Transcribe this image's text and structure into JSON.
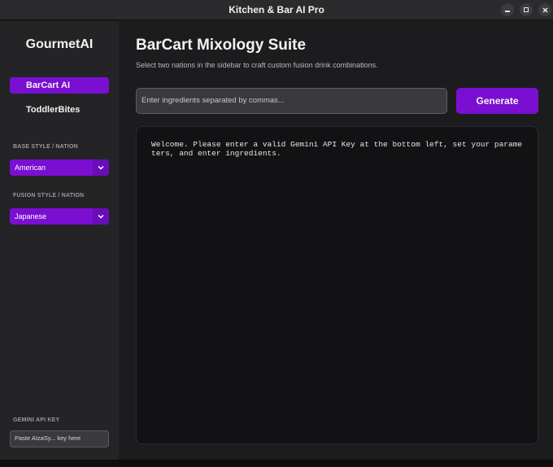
{
  "window": {
    "title": "Kitchen & Bar AI Pro",
    "controls": {
      "minimize": "minimize-icon",
      "maximize": "maximize-icon",
      "close": "close-icon"
    }
  },
  "sidebar": {
    "brand": "GourmetAI",
    "nav": [
      {
        "label": "BarCart AI",
        "active": true
      },
      {
        "label": "ToddlerBites",
        "active": false
      }
    ],
    "base_style": {
      "label": "BASE STYLE / NATION",
      "value": "American"
    },
    "fusion_style": {
      "label": "FUSION STYLE / NATION",
      "value": "Japanese"
    },
    "api_key": {
      "label": "GEMINI API KEY",
      "placeholder": "Paste AIzaSy... key here"
    }
  },
  "main": {
    "title": "BarCart Mixology Suite",
    "subtitle": "Select two nations in the sidebar to craft custom fusion drink combinations.",
    "ingredients_placeholder": "Enter ingredients separated by commas...",
    "generate_label": "Generate",
    "output_text": "Welcome. Please enter a valid Gemini API Key at the bottom left, set your parameters, and enter ingredients."
  },
  "colors": {
    "accent": "#7a0fd1",
    "background": "#1c1c1e",
    "sidebar": "#242427",
    "output_bg": "#121214"
  }
}
